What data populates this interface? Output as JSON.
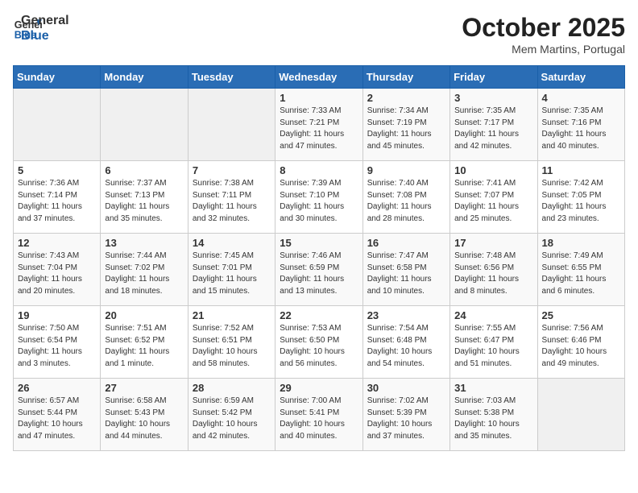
{
  "header": {
    "logo_line1": "General",
    "logo_line2": "Blue",
    "month_title": "October 2025",
    "subtitle": "Mem Martins, Portugal"
  },
  "weekdays": [
    "Sunday",
    "Monday",
    "Tuesday",
    "Wednesday",
    "Thursday",
    "Friday",
    "Saturday"
  ],
  "weeks": [
    [
      {
        "day": "",
        "sunrise": "",
        "sunset": "",
        "daylight": "",
        "empty": true
      },
      {
        "day": "",
        "sunrise": "",
        "sunset": "",
        "daylight": "",
        "empty": true
      },
      {
        "day": "",
        "sunrise": "",
        "sunset": "",
        "daylight": "",
        "empty": true
      },
      {
        "day": "1",
        "sunrise": "Sunrise: 7:33 AM",
        "sunset": "Sunset: 7:21 PM",
        "daylight": "Daylight: 11 hours and 47 minutes."
      },
      {
        "day": "2",
        "sunrise": "Sunrise: 7:34 AM",
        "sunset": "Sunset: 7:19 PM",
        "daylight": "Daylight: 11 hours and 45 minutes."
      },
      {
        "day": "3",
        "sunrise": "Sunrise: 7:35 AM",
        "sunset": "Sunset: 7:17 PM",
        "daylight": "Daylight: 11 hours and 42 minutes."
      },
      {
        "day": "4",
        "sunrise": "Sunrise: 7:35 AM",
        "sunset": "Sunset: 7:16 PM",
        "daylight": "Daylight: 11 hours and 40 minutes."
      }
    ],
    [
      {
        "day": "5",
        "sunrise": "Sunrise: 7:36 AM",
        "sunset": "Sunset: 7:14 PM",
        "daylight": "Daylight: 11 hours and 37 minutes."
      },
      {
        "day": "6",
        "sunrise": "Sunrise: 7:37 AM",
        "sunset": "Sunset: 7:13 PM",
        "daylight": "Daylight: 11 hours and 35 minutes."
      },
      {
        "day": "7",
        "sunrise": "Sunrise: 7:38 AM",
        "sunset": "Sunset: 7:11 PM",
        "daylight": "Daylight: 11 hours and 32 minutes."
      },
      {
        "day": "8",
        "sunrise": "Sunrise: 7:39 AM",
        "sunset": "Sunset: 7:10 PM",
        "daylight": "Daylight: 11 hours and 30 minutes."
      },
      {
        "day": "9",
        "sunrise": "Sunrise: 7:40 AM",
        "sunset": "Sunset: 7:08 PM",
        "daylight": "Daylight: 11 hours and 28 minutes."
      },
      {
        "day": "10",
        "sunrise": "Sunrise: 7:41 AM",
        "sunset": "Sunset: 7:07 PM",
        "daylight": "Daylight: 11 hours and 25 minutes."
      },
      {
        "day": "11",
        "sunrise": "Sunrise: 7:42 AM",
        "sunset": "Sunset: 7:05 PM",
        "daylight": "Daylight: 11 hours and 23 minutes."
      }
    ],
    [
      {
        "day": "12",
        "sunrise": "Sunrise: 7:43 AM",
        "sunset": "Sunset: 7:04 PM",
        "daylight": "Daylight: 11 hours and 20 minutes."
      },
      {
        "day": "13",
        "sunrise": "Sunrise: 7:44 AM",
        "sunset": "Sunset: 7:02 PM",
        "daylight": "Daylight: 11 hours and 18 minutes."
      },
      {
        "day": "14",
        "sunrise": "Sunrise: 7:45 AM",
        "sunset": "Sunset: 7:01 PM",
        "daylight": "Daylight: 11 hours and 15 minutes."
      },
      {
        "day": "15",
        "sunrise": "Sunrise: 7:46 AM",
        "sunset": "Sunset: 6:59 PM",
        "daylight": "Daylight: 11 hours and 13 minutes."
      },
      {
        "day": "16",
        "sunrise": "Sunrise: 7:47 AM",
        "sunset": "Sunset: 6:58 PM",
        "daylight": "Daylight: 11 hours and 10 minutes."
      },
      {
        "day": "17",
        "sunrise": "Sunrise: 7:48 AM",
        "sunset": "Sunset: 6:56 PM",
        "daylight": "Daylight: 11 hours and 8 minutes."
      },
      {
        "day": "18",
        "sunrise": "Sunrise: 7:49 AM",
        "sunset": "Sunset: 6:55 PM",
        "daylight": "Daylight: 11 hours and 6 minutes."
      }
    ],
    [
      {
        "day": "19",
        "sunrise": "Sunrise: 7:50 AM",
        "sunset": "Sunset: 6:54 PM",
        "daylight": "Daylight: 11 hours and 3 minutes."
      },
      {
        "day": "20",
        "sunrise": "Sunrise: 7:51 AM",
        "sunset": "Sunset: 6:52 PM",
        "daylight": "Daylight: 11 hours and 1 minute."
      },
      {
        "day": "21",
        "sunrise": "Sunrise: 7:52 AM",
        "sunset": "Sunset: 6:51 PM",
        "daylight": "Daylight: 10 hours and 58 minutes."
      },
      {
        "day": "22",
        "sunrise": "Sunrise: 7:53 AM",
        "sunset": "Sunset: 6:50 PM",
        "daylight": "Daylight: 10 hours and 56 minutes."
      },
      {
        "day": "23",
        "sunrise": "Sunrise: 7:54 AM",
        "sunset": "Sunset: 6:48 PM",
        "daylight": "Daylight: 10 hours and 54 minutes."
      },
      {
        "day": "24",
        "sunrise": "Sunrise: 7:55 AM",
        "sunset": "Sunset: 6:47 PM",
        "daylight": "Daylight: 10 hours and 51 minutes."
      },
      {
        "day": "25",
        "sunrise": "Sunrise: 7:56 AM",
        "sunset": "Sunset: 6:46 PM",
        "daylight": "Daylight: 10 hours and 49 minutes."
      }
    ],
    [
      {
        "day": "26",
        "sunrise": "Sunrise: 6:57 AM",
        "sunset": "Sunset: 5:44 PM",
        "daylight": "Daylight: 10 hours and 47 minutes."
      },
      {
        "day": "27",
        "sunrise": "Sunrise: 6:58 AM",
        "sunset": "Sunset: 5:43 PM",
        "daylight": "Daylight: 10 hours and 44 minutes."
      },
      {
        "day": "28",
        "sunrise": "Sunrise: 6:59 AM",
        "sunset": "Sunset: 5:42 PM",
        "daylight": "Daylight: 10 hours and 42 minutes."
      },
      {
        "day": "29",
        "sunrise": "Sunrise: 7:00 AM",
        "sunset": "Sunset: 5:41 PM",
        "daylight": "Daylight: 10 hours and 40 minutes."
      },
      {
        "day": "30",
        "sunrise": "Sunrise: 7:02 AM",
        "sunset": "Sunset: 5:39 PM",
        "daylight": "Daylight: 10 hours and 37 minutes."
      },
      {
        "day": "31",
        "sunrise": "Sunrise: 7:03 AM",
        "sunset": "Sunset: 5:38 PM",
        "daylight": "Daylight: 10 hours and 35 minutes."
      },
      {
        "day": "",
        "sunrise": "",
        "sunset": "",
        "daylight": "",
        "empty": true
      }
    ]
  ]
}
